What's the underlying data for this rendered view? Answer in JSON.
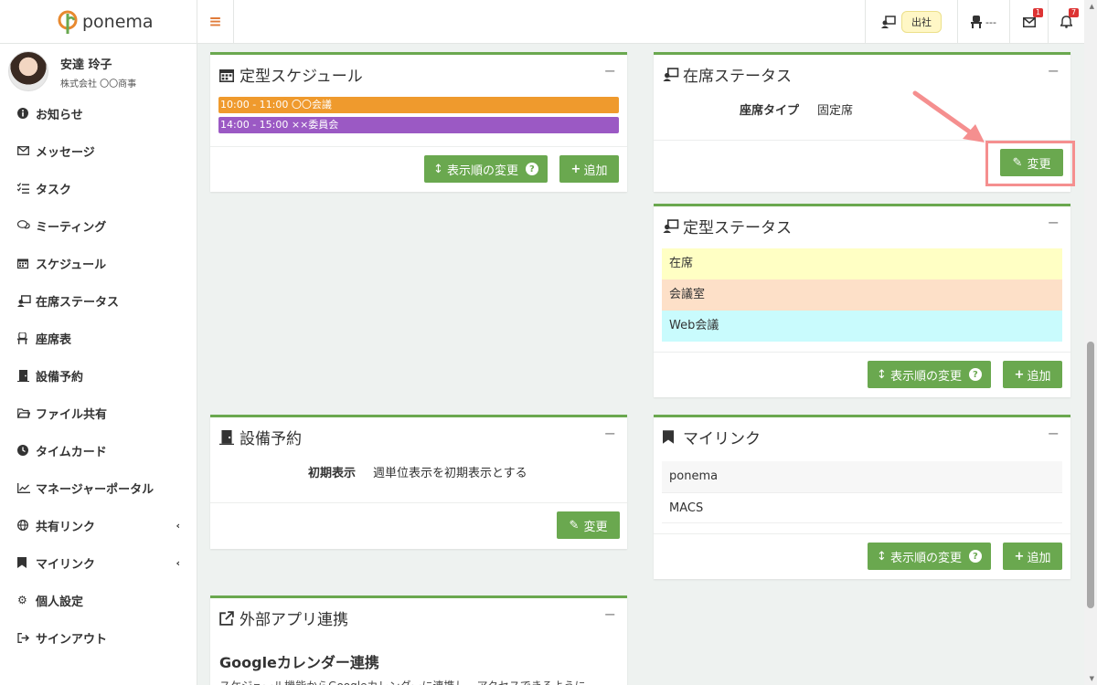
{
  "app": {
    "name": "ponema"
  },
  "topbar": {
    "status_label": "出社",
    "seat_label": "---",
    "mail_badge": "1",
    "bell_badge": "7"
  },
  "user": {
    "name": "安達 玲子",
    "company": "株式会社 〇〇商事"
  },
  "sidebar": {
    "items": [
      {
        "label": "お知らせ",
        "icon": "info-icon"
      },
      {
        "label": "メッセージ",
        "icon": "envelope-icon"
      },
      {
        "label": "タスク",
        "icon": "tasks-icon"
      },
      {
        "label": "ミーティング",
        "icon": "chat-icon"
      },
      {
        "label": "スケジュール",
        "icon": "calendar-icon"
      },
      {
        "label": "在席ステータス",
        "icon": "presence-icon"
      },
      {
        "label": "座席表",
        "icon": "chair-icon"
      },
      {
        "label": "設備予約",
        "icon": "door-icon"
      },
      {
        "label": "ファイル共有",
        "icon": "folder-icon"
      },
      {
        "label": "タイムカード",
        "icon": "clock-icon"
      },
      {
        "label": "マネージャーポータル",
        "icon": "chart-icon"
      },
      {
        "label": "共有リンク",
        "icon": "globe-icon"
      },
      {
        "label": "マイリンク",
        "icon": "bookmark-icon"
      },
      {
        "label": "個人設定",
        "icon": "gear-icon"
      },
      {
        "label": "サインアウト",
        "icon": "signout-icon"
      }
    ]
  },
  "cards": {
    "schedule": {
      "title": "定型スケジュール",
      "events": [
        {
          "label": "10:00 - 11:00  〇〇会議",
          "color": "#ef9a2d"
        },
        {
          "label": "14:00 - 15:00  ××委員会",
          "color": "#9b59c4"
        }
      ],
      "reorder_label": "表示順の変更",
      "add_label": "追加"
    },
    "presence": {
      "title": "在席ステータス",
      "seat_type_label": "座席タイプ",
      "seat_type_value": "固定席",
      "change_label": "変更"
    },
    "regular_status": {
      "title": "定型ステータス",
      "items": [
        {
          "label": "在席",
          "color": "#ffffc4"
        },
        {
          "label": "会議室",
          "color": "#fde0c8"
        },
        {
          "label": "Web会議",
          "color": "#c9fbfd"
        }
      ],
      "reorder_label": "表示順の変更",
      "add_label": "追加"
    },
    "facility": {
      "title": "設備予約",
      "initial_label": "初期表示",
      "initial_value": "週単位表示を初期表示とする",
      "change_label": "変更"
    },
    "mylink": {
      "title": "マイリンク",
      "links": [
        "ponema",
        "MACS"
      ],
      "reorder_label": "表示順の変更",
      "add_label": "追加"
    },
    "external": {
      "title": "外部アプリ連携",
      "section_title": "Googleカレンダー連携",
      "description": "スケジュール機能からGoogleカレンダーに連携し、アクセスできるように"
    }
  },
  "colors": {
    "accent": "#6aa84f",
    "highlight": "#f58f8f",
    "menu_icon": "#e07b39"
  }
}
